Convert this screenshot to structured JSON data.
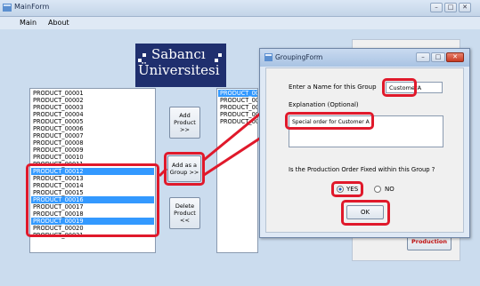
{
  "window": {
    "title": "MainForm",
    "controls": [
      "–",
      "□",
      "✕"
    ]
  },
  "menu": {
    "items": [
      "Main",
      "About"
    ]
  },
  "logo": {
    "line1": "Sabancı",
    "line2": "Üniversitesi"
  },
  "product_list": {
    "items": [
      "PRODUCT_00001",
      "PRODUCT_00002",
      "PRODUCT_00003",
      "PRODUCT_00004",
      "PRODUCT_00005",
      "PRODUCT_00006",
      "PRODUCT_00007",
      "PRODUCT_00008",
      "PRODUCT_00009",
      "PRODUCT_00010",
      "PRODUCT_00011",
      "PRODUCT_00012",
      "PRODUCT_00013",
      "PRODUCT_00014",
      "PRODUCT_00015",
      "PRODUCT_00016",
      "PRODUCT_00017",
      "PRODUCT_00018",
      "PRODUCT_00019",
      "PRODUCT_00020",
      "PRODUCT_00021"
    ],
    "selected": [
      "PRODUCT_00012",
      "PRODUCT_00016",
      "PRODUCT_00019"
    ]
  },
  "selected_list": {
    "items": [
      "PRODUCT_000",
      "PRODUCT_000",
      "PRODUCT_000",
      "PRODUCT_000",
      "PRODUCT_000"
    ],
    "selected_index": 0
  },
  "buttons": {
    "add_product": "Add\nProduct\n>>",
    "add_group": "Add as a\nGroup >>",
    "delete_product": "Delete\nProduct\n<<",
    "production": "Production"
  },
  "dialog": {
    "title": "GroupingForm",
    "name_label": "Enter a Name for this Group",
    "name_value": "CustomerA",
    "explanation_label": "Explanation (Optional)",
    "explanation_value": "Special order for Customer A",
    "fixed_question": "Is the Production Order Fixed within this Group ?",
    "yes_label": "YES",
    "no_label": "NO",
    "yes_selected": true,
    "ok_label": "OK"
  },
  "colors": {
    "highlight": "#e0192b",
    "selection": "#3399ff",
    "logo_bg": "#1f2f6e"
  }
}
